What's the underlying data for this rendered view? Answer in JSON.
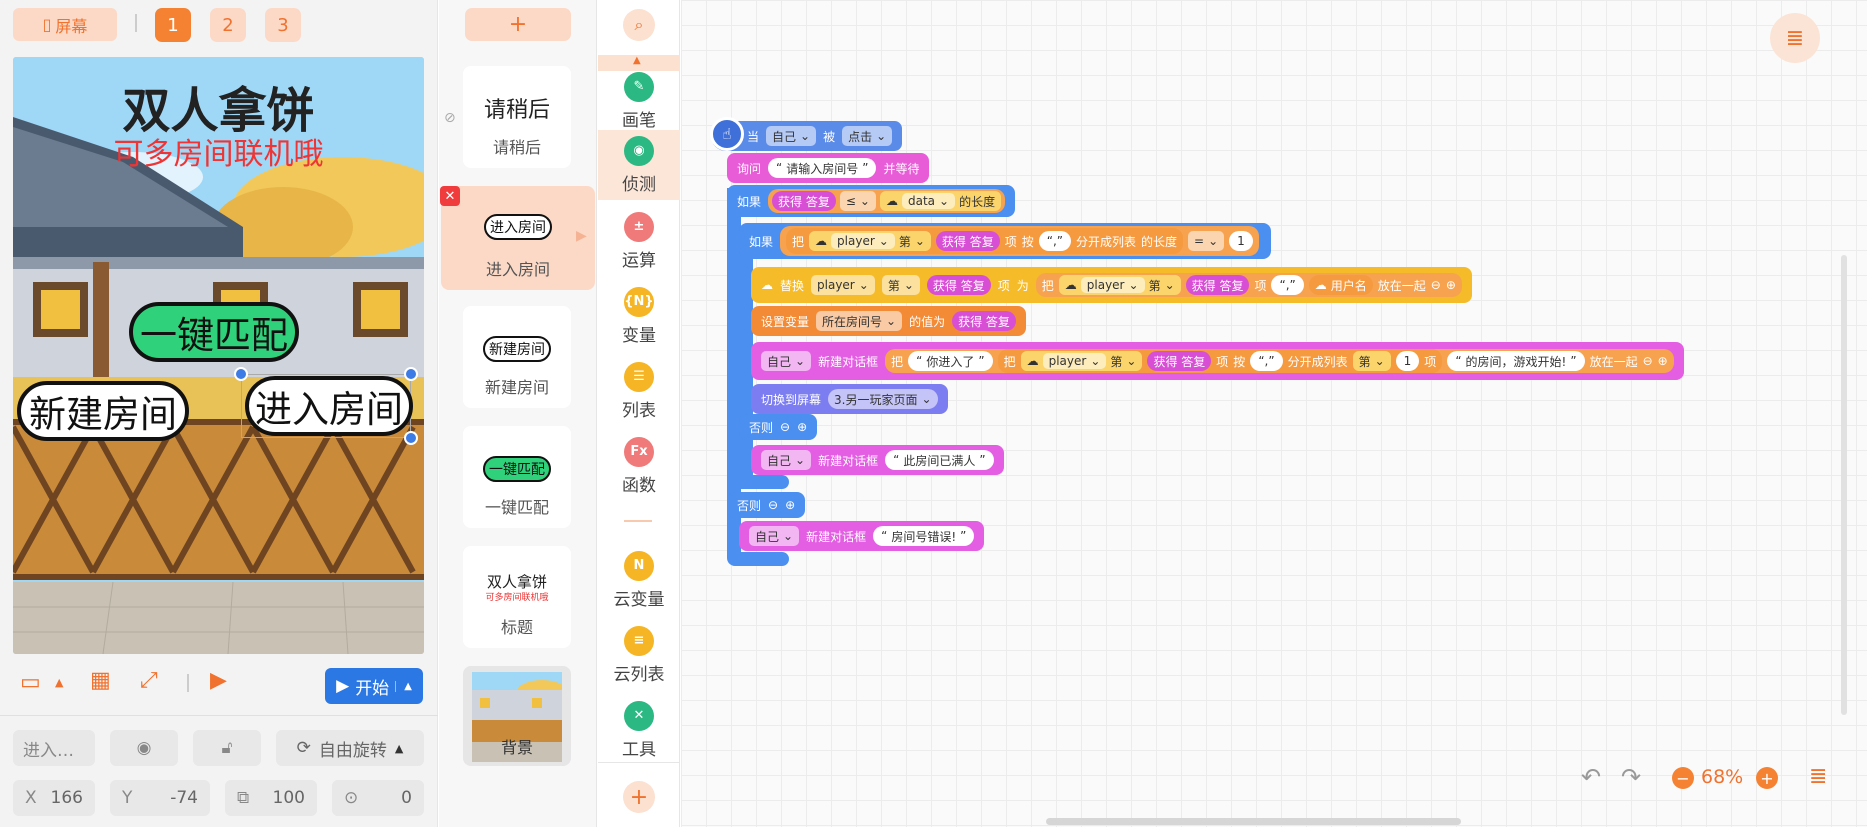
{
  "topbar": {
    "screen_button": "屏幕",
    "pages": [
      "1",
      "2",
      "3"
    ],
    "add_sprite": "+"
  },
  "stage": {
    "title": "双人拿饼",
    "subtitle": "可多房间联机哦",
    "btn_match": "一键匹配",
    "btn_new_room": "新建房间",
    "btn_enter_room": "进入房间"
  },
  "stage_controls": {
    "start_label": "开始"
  },
  "properties": {
    "name": "进入…",
    "rotation_mode": "自由旋转",
    "x_label": "X",
    "x": "166",
    "y_label": "Y",
    "y": "-74",
    "size": "100",
    "direction": "0"
  },
  "sprites": [
    {
      "thumb": "请稍后",
      "label": "请稍后"
    },
    {
      "thumb": "进入房间",
      "label": "进入房间"
    },
    {
      "thumb": "新建房间",
      "label": "新建房间"
    },
    {
      "thumb": "一键匹配",
      "label": "一键匹配"
    },
    {
      "thumb_title": "双人拿饼",
      "thumb_sub": "可多房间联机哦",
      "label": "标题"
    },
    {
      "label": "背景"
    }
  ],
  "categories": [
    {
      "label": "画笔",
      "icon": "pen-icon",
      "color": "#2cb882",
      "glyph": "✎"
    },
    {
      "label": "侦测",
      "icon": "sensing-icon",
      "color": "#2cb882",
      "glyph": "◉"
    },
    {
      "label": "运算",
      "icon": "operator-icon",
      "color": "#f07a7a",
      "glyph": "±"
    },
    {
      "label": "变量",
      "icon": "variable-icon",
      "color": "#f5b524",
      "glyph": "{N}"
    },
    {
      "label": "列表",
      "icon": "list-icon",
      "color": "#f5b524",
      "glyph": "☰"
    },
    {
      "label": "函数",
      "icon": "function-icon",
      "color": "#f07a7a",
      "glyph": "Fx"
    },
    {
      "label": "云变量",
      "icon": "cloud-variable-icon",
      "color": "#f5b524",
      "glyph": "N"
    },
    {
      "label": "云列表",
      "icon": "cloud-list-icon",
      "color": "#f5b524",
      "glyph": "≡"
    },
    {
      "label": "工具",
      "icon": "tools-icon",
      "color": "#2cb882",
      "glyph": "✕"
    }
  ],
  "blocks": {
    "event_when": "当",
    "self": "自己",
    "event_clicked": "被",
    "click": "点击",
    "ask": "询问",
    "ask_prompt": "请输入房间号",
    "ask_wait": "并等待",
    "if": "如果",
    "get_answer": "获得 答复",
    "lte": "≤",
    "data": "data",
    "length_of": "的长度",
    "take": "把",
    "player": "player",
    "index_word": "第",
    "item_word": "项",
    "by": "按",
    "comma": "“,”",
    "split": "分开成列表",
    "eq": "=",
    "one": "1",
    "replace": "替换",
    "as": "为",
    "username": "用户名",
    "join": "放在一起",
    "set_var": "设置变量",
    "room_var": "所在房间号",
    "value_is": "的值为",
    "new_dialog": "新建对话框",
    "you_entered": "你进入了",
    "room_msg": "的房间，游戏开始!",
    "switch_screen": "切换到屏幕",
    "screen_target": "3.另一玩家页面",
    "else": "否则",
    "full_msg": "此房间已满人",
    "err_msg": "房间号错误!"
  },
  "workspace": {
    "zoom": "68%"
  }
}
